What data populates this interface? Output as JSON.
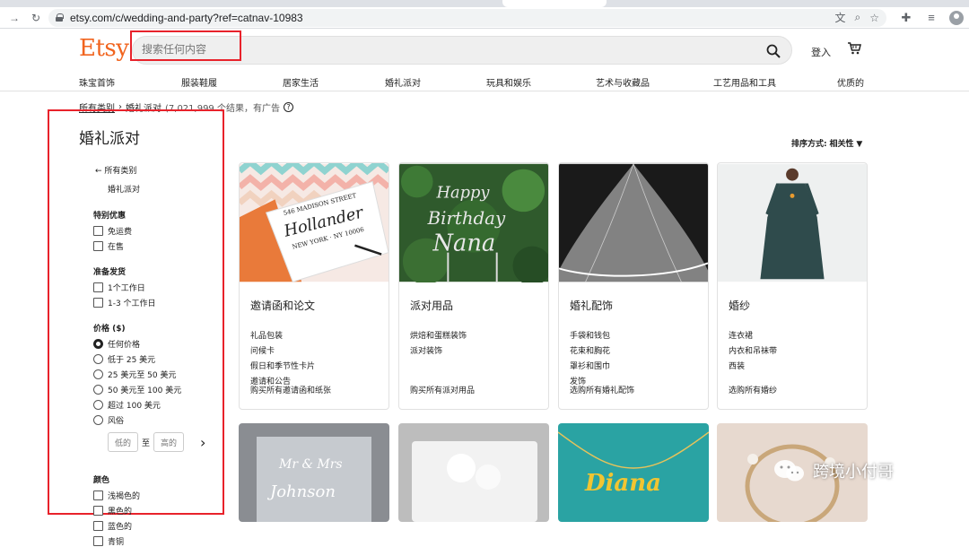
{
  "browser": {
    "url": "etsy.com/c/wedding-and-party?ref=catnav-10983",
    "url_host": "etsy.com",
    "url_path": "/c/wedding-and-party?ref=catnav-10983"
  },
  "header": {
    "logo": "Etsy",
    "search_placeholder": "搜索任何内容",
    "signin": "登入"
  },
  "catnav": [
    "珠宝首饰",
    "服装鞋履",
    "居家生活",
    "婚礼派对",
    "玩具和娱乐",
    "艺术与收藏品",
    "工艺用品和工具",
    "优质的"
  ],
  "breadcrumb": {
    "root": "所有类别",
    "sep": "›",
    "current": "婚礼派对",
    "count": "(7,021,999 个结果，有广告",
    "help": "?"
  },
  "sidebar": {
    "title": "婚礼派对",
    "back": "← 所有类别",
    "current": "婚礼派对",
    "special": {
      "title": "特别优惠",
      "options": [
        "免运费",
        "在售"
      ]
    },
    "ready": {
      "title": "准备发货",
      "options": [
        "1个工作日",
        "1-3 个工作日"
      ]
    },
    "price": {
      "title": "价格 ($)",
      "options": [
        "任何价格",
        "低于 25 美元",
        "25 美元至 50 美元",
        "50 美元至 100 美元",
        "超过 100 美元",
        "风俗"
      ],
      "low": "低的",
      "to": "至",
      "high": "高的"
    },
    "color": {
      "title": "颜色",
      "options": [
        "浅褐色的",
        "黑色的",
        "蓝色的",
        "青铜"
      ]
    }
  },
  "sort": {
    "label": "排序方式:",
    "value": "相关性"
  },
  "cards": [
    {
      "title": "邀请函和论文",
      "links": [
        "礼品包装",
        "问候卡",
        "假日和季节性卡片",
        "邀请和公告"
      ],
      "shopall": "购买所有邀请函和纸张"
    },
    {
      "title": "派对用品",
      "links": [
        "烘焙和蛋糕装饰",
        "派对装饰"
      ],
      "shopall": "购买所有派对用品"
    },
    {
      "title": "婚礼配饰",
      "links": [
        "手袋和钱包",
        "花束和胸花",
        "罩衫和围巾",
        "发饰"
      ],
      "shopall": "选购所有婚礼配饰"
    },
    {
      "title": "婚纱",
      "links": [
        "连衣裙",
        "内衣和吊袜带",
        "西装"
      ],
      "shopall": "选购所有婚纱"
    }
  ],
  "image_text": {
    "addr1": "546 MADISON STREET",
    "name": "Hollander",
    "addr2": "NEW YORK · NY 10006",
    "happy": "Happy",
    "birthday": "Birthday",
    "nana": "Nana",
    "name2": "Diana"
  },
  "watermark": "跨境小付哥",
  "colors": {
    "accent": "#f1641e",
    "highlight": "#e8222b"
  }
}
